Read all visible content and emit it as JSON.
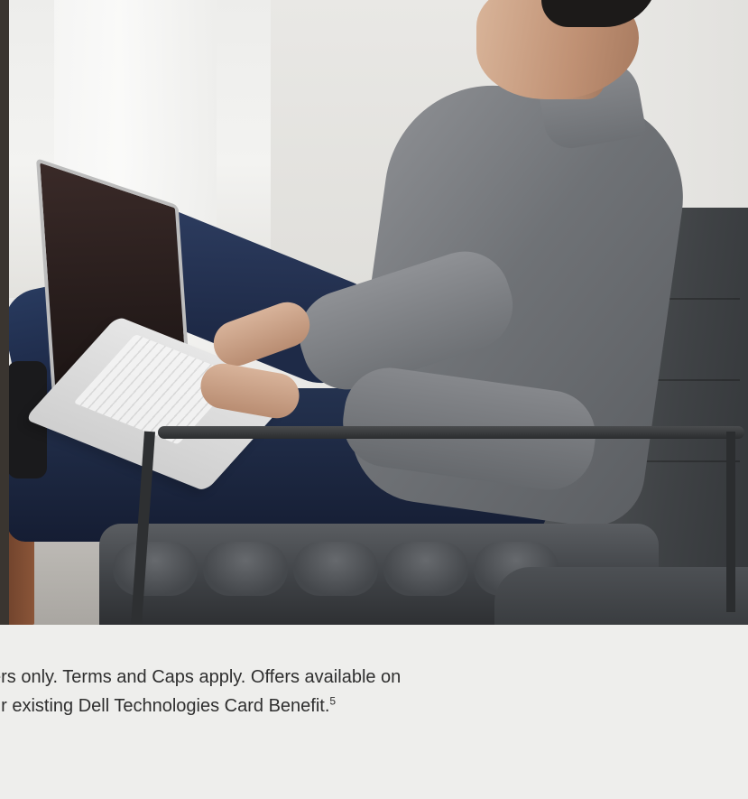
{
  "hero": {
    "image_alt": "Man in gray shirt typing on a laptop while sitting in a dark leather lounge chair"
  },
  "disclaimer": {
    "line1": "ers only. Terms and Caps apply. Offers available on",
    "line2": "ur existing Dell Technologies Card Benefit.",
    "footnote": "5"
  },
  "colors": {
    "background": "#eeeeec",
    "text": "#2f2f2f"
  }
}
